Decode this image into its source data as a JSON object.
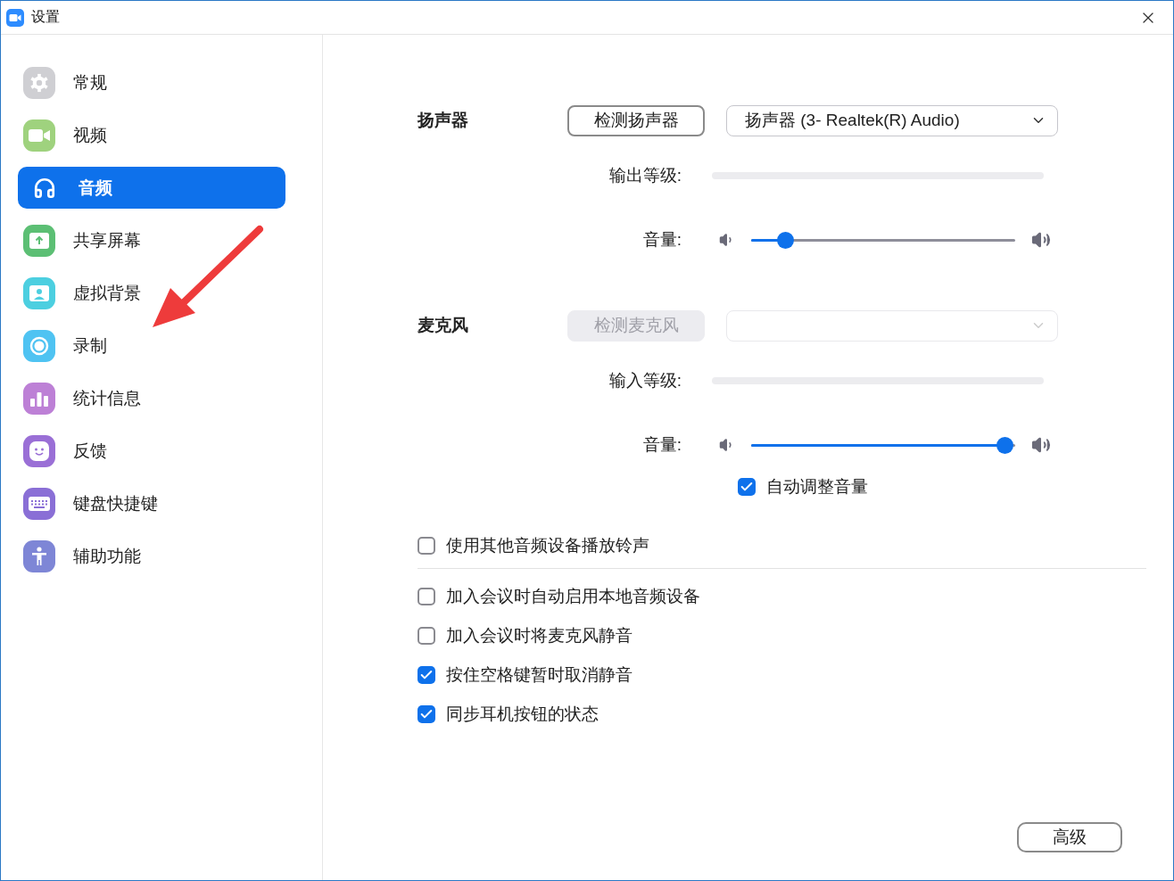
{
  "window": {
    "title": "设置"
  },
  "sidebar": {
    "items": [
      {
        "label": "常规",
        "kind": "gear",
        "color": "#cfcfd3",
        "selected": false
      },
      {
        "label": "视频",
        "kind": "video",
        "color": "#9fd27e",
        "selected": false
      },
      {
        "label": "音频",
        "kind": "headphones",
        "color": "#ffffff",
        "selected": true
      },
      {
        "label": "共享屏幕",
        "kind": "share",
        "color": "#5cbf74",
        "selected": false
      },
      {
        "label": "虚拟背景",
        "kind": "person",
        "color": "#4ccfe0",
        "selected": false
      },
      {
        "label": "录制",
        "kind": "record",
        "color": "#4fc3f2",
        "selected": false
      },
      {
        "label": "统计信息",
        "kind": "stats",
        "color": "#bd80d6",
        "selected": false
      },
      {
        "label": "反馈",
        "kind": "smile",
        "color": "#9a6fd6",
        "selected": false
      },
      {
        "label": "键盘快捷键",
        "kind": "keyboard",
        "color": "#8a6fd6",
        "selected": false
      },
      {
        "label": "辅助功能",
        "kind": "accessibility",
        "color": "#7e86d6",
        "selected": false
      }
    ]
  },
  "annotation_arrow": true,
  "speaker": {
    "label": "扬声器",
    "test_button": {
      "label": "检测扬声器",
      "disabled": false
    },
    "device": {
      "value": "扬声器 (3- Realtek(R) Audio)",
      "disabled": false
    },
    "level_label": "输出等级:",
    "volume_label": "音量:",
    "volume": {
      "level": 0.13
    }
  },
  "microphone": {
    "label": "麦克风",
    "test_button": {
      "label": "检测麦克风",
      "disabled": true
    },
    "device": {
      "disabled": true
    },
    "level_label": "输入等级:",
    "volume_label": "音量:",
    "volume": {
      "level": 0.96
    },
    "auto_adjust": {
      "label": "自动调整音量",
      "checked": true
    }
  },
  "ringtone_option": {
    "label": "使用其他音频设备播放铃声",
    "checked": false
  },
  "options": [
    {
      "label": "加入会议时自动启用本地音频设备",
      "checked": false
    },
    {
      "label": "加入会议时将麦克风静音",
      "checked": false
    },
    {
      "label": "按住空格键暂时取消静音",
      "checked": true
    },
    {
      "label": "同步耳机按钮的状态",
      "checked": true
    }
  ],
  "advanced_button": "高级"
}
